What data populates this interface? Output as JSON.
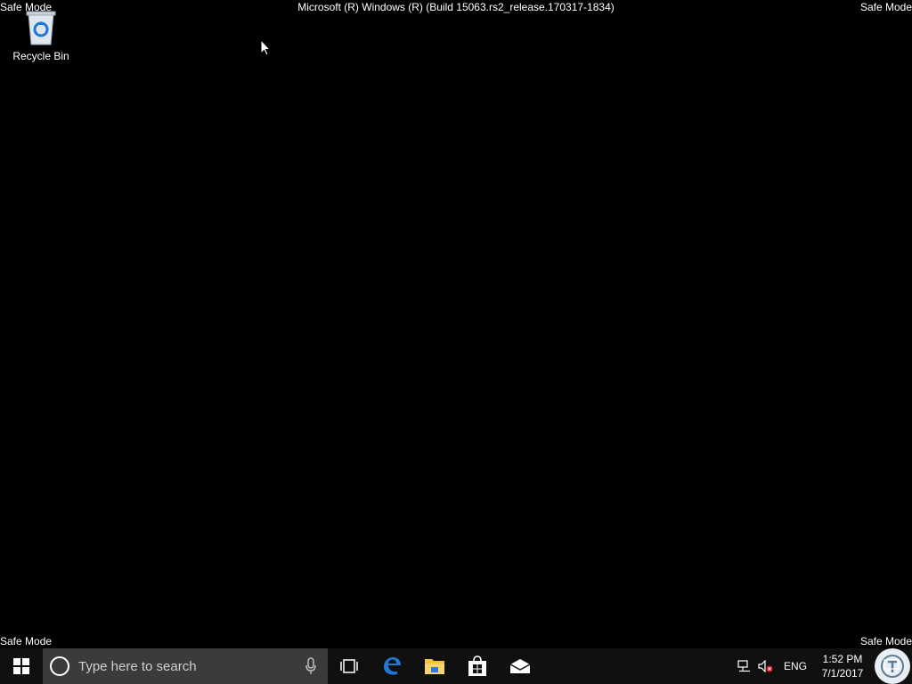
{
  "overlay": {
    "safe_mode_label": "Safe Mode",
    "build_text": "Microsoft (R) Windows (R) (Build 15063.rs2_release.170317-1834)"
  },
  "desktop": {
    "icons": [
      {
        "label": "Recycle Bin",
        "icon": "recycle-bin-icon"
      }
    ]
  },
  "taskbar": {
    "search_placeholder": "Type here to search",
    "pinned": [
      "task-view-icon",
      "edge-icon",
      "file-explorer-icon",
      "store-icon",
      "mail-icon"
    ],
    "tray": {
      "language": "ENG",
      "time": "1:52 PM",
      "date": "7/1/2017"
    }
  },
  "colors": {
    "desktop_bg": "#000000",
    "taskbar_bg": "#101010",
    "search_bg": "#3b3b3b",
    "edge_blue": "#1e78d7",
    "explorer_yellow": "#f5c33b"
  }
}
